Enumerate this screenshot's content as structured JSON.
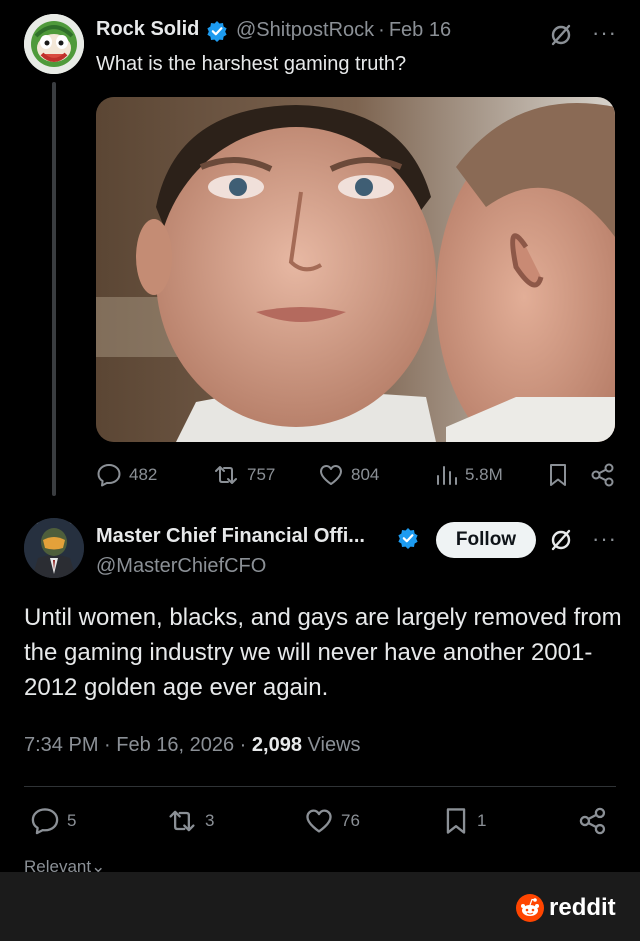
{
  "post1": {
    "display_name": "Rock Solid",
    "handle": "@ShitpostRock",
    "date": "Feb 16",
    "text": "What is the harshest gaming truth?",
    "stats": {
      "replies": "482",
      "reposts": "757",
      "likes": "804",
      "views": "5.8M"
    }
  },
  "post2": {
    "display_name": "Master Chief Financial Offi...",
    "handle": "@MasterChiefCFO",
    "follow_label": "Follow",
    "text": "Until women, blacks, and gays are largely removed from the gaming industry we will never have another 2001-2012 golden age ever again.",
    "time": "7:34 PM · Feb 16, 2026 · ",
    "views_count": "2,098",
    "views_label": "Views",
    "stats": {
      "replies": "5",
      "reposts": "3",
      "likes": "76",
      "bookmarks": "1"
    },
    "sort_label": "Relevant"
  },
  "footer": {
    "brand": "reddit"
  },
  "colors": {
    "background": "#000000",
    "text": "#e7e9ea",
    "muted": "#8b9096",
    "verified": "#1d9bf0",
    "reddit_orange": "#ff4500"
  },
  "icons": [
    "grok-icon",
    "more-icon",
    "reply-icon",
    "repost-icon",
    "like-icon",
    "views-icon",
    "bookmark-icon",
    "share-icon",
    "verified-badge-icon"
  ]
}
